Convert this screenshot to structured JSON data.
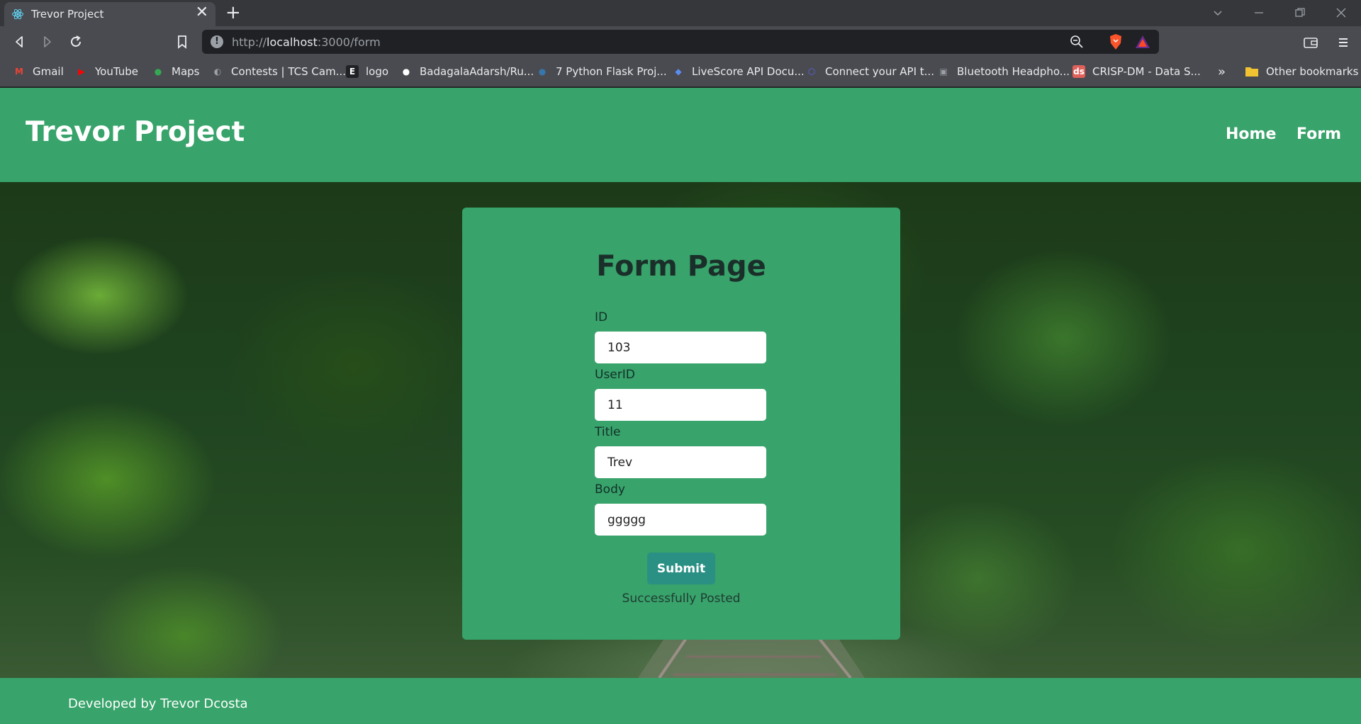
{
  "browser": {
    "tab_title": "Trevor Project",
    "tab_close": "✕",
    "new_tab": "+",
    "url_scheme": "http://",
    "url_host": "localhost",
    "url_path": ":3000/form",
    "info_icon": "!"
  },
  "bookmarks": [
    {
      "label": "Gmail",
      "icon": "gmail-icon",
      "glyph": "M",
      "color": "#ea4335"
    },
    {
      "label": "YouTube",
      "icon": "youtube-icon",
      "glyph": "▶",
      "color": "#ff0000"
    },
    {
      "label": "Maps",
      "icon": "maps-icon",
      "glyph": "●",
      "color": "#34a853"
    },
    {
      "label": "Contests | TCS Cam...",
      "icon": "globe-icon",
      "glyph": "◐",
      "color": "#9aa0a6"
    },
    {
      "label": "logo",
      "icon": "e-logo-icon",
      "glyph": "E",
      "color": "#202124"
    },
    {
      "label": "BadagalaAdarsh/Ru...",
      "icon": "github-icon",
      "glyph": "●",
      "color": "#202124"
    },
    {
      "label": "7 Python Flask Proj...",
      "icon": "python-icon",
      "glyph": "●",
      "color": "#3776ab"
    },
    {
      "label": "LiveScore API Docu...",
      "icon": "livescore-icon",
      "glyph": "◆",
      "color": "#5b8def"
    },
    {
      "label": "Connect your API t...",
      "icon": "hexagon-icon",
      "glyph": "⬡",
      "color": "#5865f2"
    },
    {
      "label": "Bluetooth Headpho...",
      "icon": "store-icon",
      "glyph": "▣",
      "color": "#9aa0a6"
    },
    {
      "label": "CRISP-DM - Data S...",
      "icon": "ds-icon",
      "glyph": "ds",
      "color": "#e0605a"
    }
  ],
  "bookmarks_overflow": "»",
  "other_bookmarks": "Other bookmarks",
  "site": {
    "brand": "Trevor Project",
    "nav": {
      "home": "Home",
      "form": "Form"
    },
    "footer": "Developed by Trevor Dcosta",
    "accent": "#38a36a"
  },
  "form": {
    "title": "Form Page",
    "fields": [
      {
        "label": "ID",
        "value": "103"
      },
      {
        "label": "UserID",
        "value": "11"
      },
      {
        "label": "Title",
        "value": "Trev"
      },
      {
        "label": "Body",
        "value": "ggggg"
      }
    ],
    "submit_label": "Submit",
    "status": "Successfully Posted"
  }
}
